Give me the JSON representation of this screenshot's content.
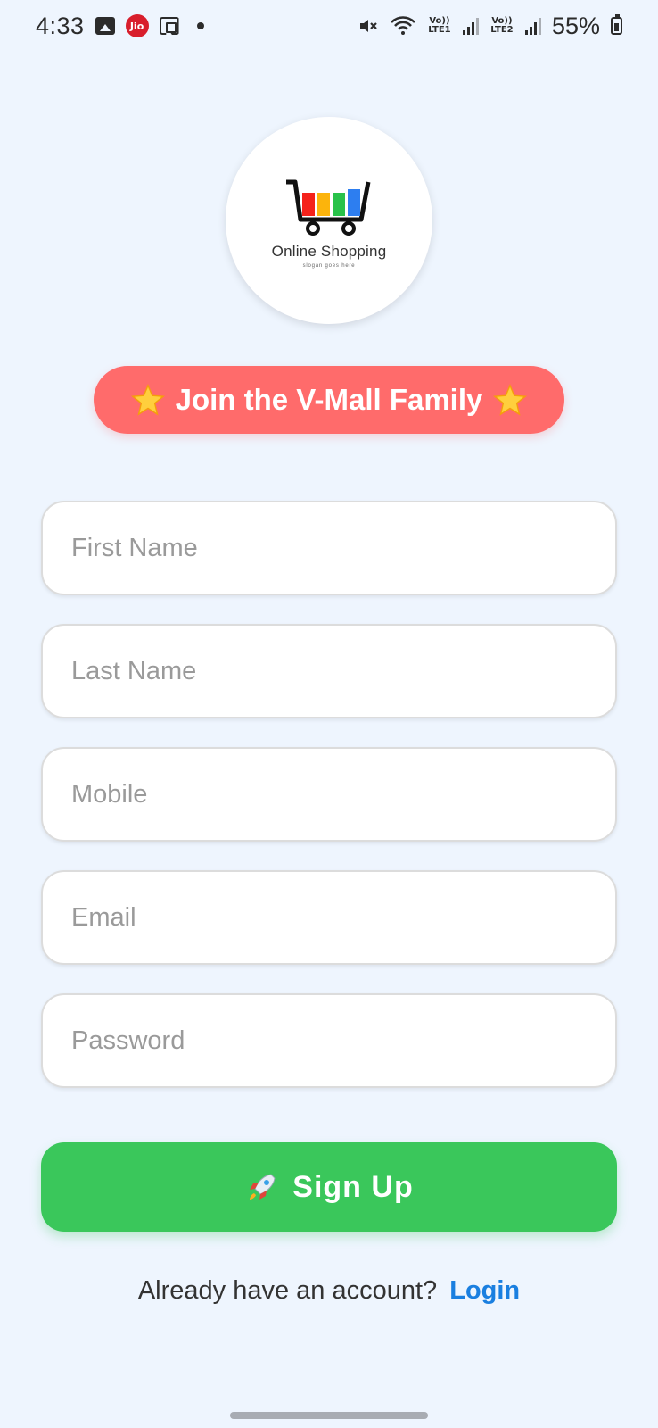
{
  "status_bar": {
    "time": "4:33",
    "carrier_badge": "Jio",
    "lte1": "Vo)) LTE1",
    "lte2": "Vo)) LTE2",
    "battery": "55%",
    "icons": [
      "image-icon",
      "jio-icon",
      "screen-record-icon",
      "dot-icon",
      "mute-icon",
      "wifi-icon",
      "signal-icon",
      "battery-icon"
    ]
  },
  "logo": {
    "title": "Online Shopping",
    "slogan": "slogan goes here",
    "bar_colors": [
      "#f5221b",
      "#fcb40c",
      "#29c24a",
      "#2d7ef0"
    ]
  },
  "banner": {
    "text": "Join the V-Mall Family",
    "color": "#ff6b6b"
  },
  "form": {
    "first_name_placeholder": "First Name",
    "last_name_placeholder": "Last Name",
    "mobile_placeholder": "Mobile",
    "email_placeholder": "Email",
    "password_placeholder": "Password"
  },
  "signup_button": {
    "label": "Sign Up",
    "color": "#3ac75b"
  },
  "login_prompt": {
    "text": "Already have an account?",
    "link": "Login",
    "link_color": "#1a7fe0"
  }
}
